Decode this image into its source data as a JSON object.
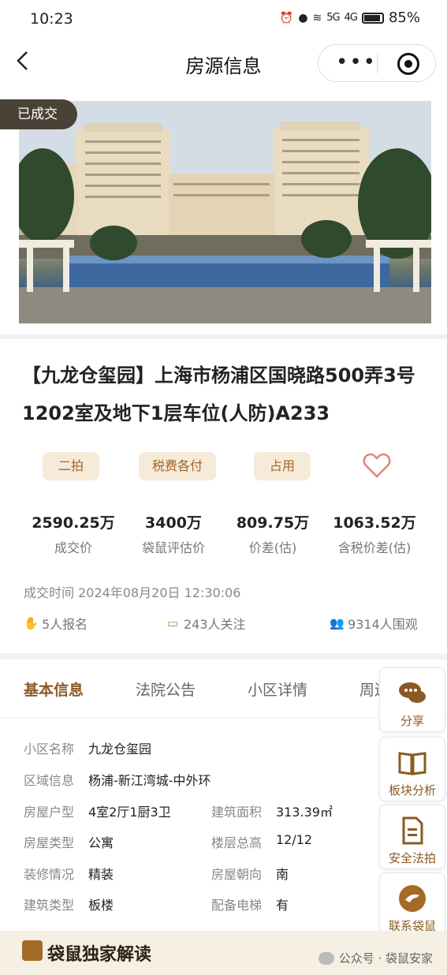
{
  "status_bar": {
    "time": "10:23",
    "signal_1": "5G",
    "signal_2": "4G",
    "battery_percent": "85%"
  },
  "header": {
    "title": "房源信息"
  },
  "listing": {
    "badge": "已成交",
    "title": "【九龙仓玺园】上海市杨浦区国晓路500弄3号1202室及地下1层车位(人防)A233",
    "tags": [
      "二拍",
      "税费各付",
      "占用"
    ]
  },
  "stats": [
    {
      "value": "2590.25万",
      "label": "成交价"
    },
    {
      "value": "3400万",
      "label": "袋鼠评估价"
    },
    {
      "value": "809.75万",
      "label": "价差(估)"
    },
    {
      "value": "1063.52万",
      "label": "含税价差(估)"
    }
  ],
  "deal_time": "成交时间 2024年08月20日 12:30:06",
  "counters": {
    "signups": "5人报名",
    "followers": "243人关注",
    "viewers": "9314人围观"
  },
  "tabs": [
    "基本信息",
    "法院公告",
    "小区详情",
    "周边"
  ],
  "basic_info": {
    "community_label": "小区名称",
    "community": "九龙仓玺园",
    "region_label": "区域信息",
    "region": "杨浦-新江湾城-中外环",
    "layout_label": "房屋户型",
    "layout": "4室2厅1厨3卫",
    "area_label": "建筑面积",
    "area": "313.39㎡",
    "type_label": "房屋类型",
    "type": "公寓",
    "floors_label": "楼层总高",
    "floors": "12/12",
    "decor_label": "装修情况",
    "decor": "精装",
    "orientation_label": "房屋朝向",
    "orientation": "南",
    "building_label": "建筑类型",
    "building": "板楼",
    "elevator_label": "配备电梯",
    "elevator": "有"
  },
  "side_actions": {
    "share": "分享",
    "analysis": "板块分析",
    "safe": "安全法拍",
    "contact": "联系袋鼠"
  },
  "bottom": {
    "title": "袋鼠独家解读",
    "watermark": "公众号 · 袋鼠安家"
  },
  "colors": {
    "accent": "#8b5a23",
    "tag_bg": "#f6ead9",
    "heart": "#e0867a"
  }
}
